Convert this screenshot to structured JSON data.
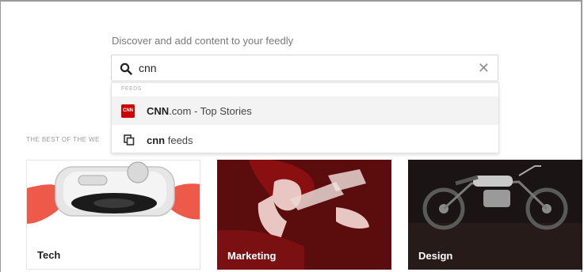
{
  "header": {
    "discover_text": "Discover and add content to your feedly"
  },
  "search": {
    "value": "cnn",
    "placeholder": "",
    "clear_symbol": "✕"
  },
  "dropdown": {
    "section_label": "FEEDS",
    "items": [
      {
        "logo_text": "CNN",
        "bold": "CNN",
        "rest": ".com - Top Stories"
      },
      {
        "bold": "cnn",
        "rest": " feeds"
      }
    ]
  },
  "best_label": "THE BEST OF THE WE",
  "cards": [
    {
      "title": "Tech",
      "image": "apple-watch"
    },
    {
      "title": "Marketing",
      "image": "woman-drinking"
    },
    {
      "title": "Design",
      "image": "motorcycle"
    }
  ],
  "colors": {
    "cnn_red": "#cc0000",
    "marketing_bg": "#5b0d0d",
    "design_bg": "#1b1414",
    "watch_band": "#ee5a4a"
  }
}
